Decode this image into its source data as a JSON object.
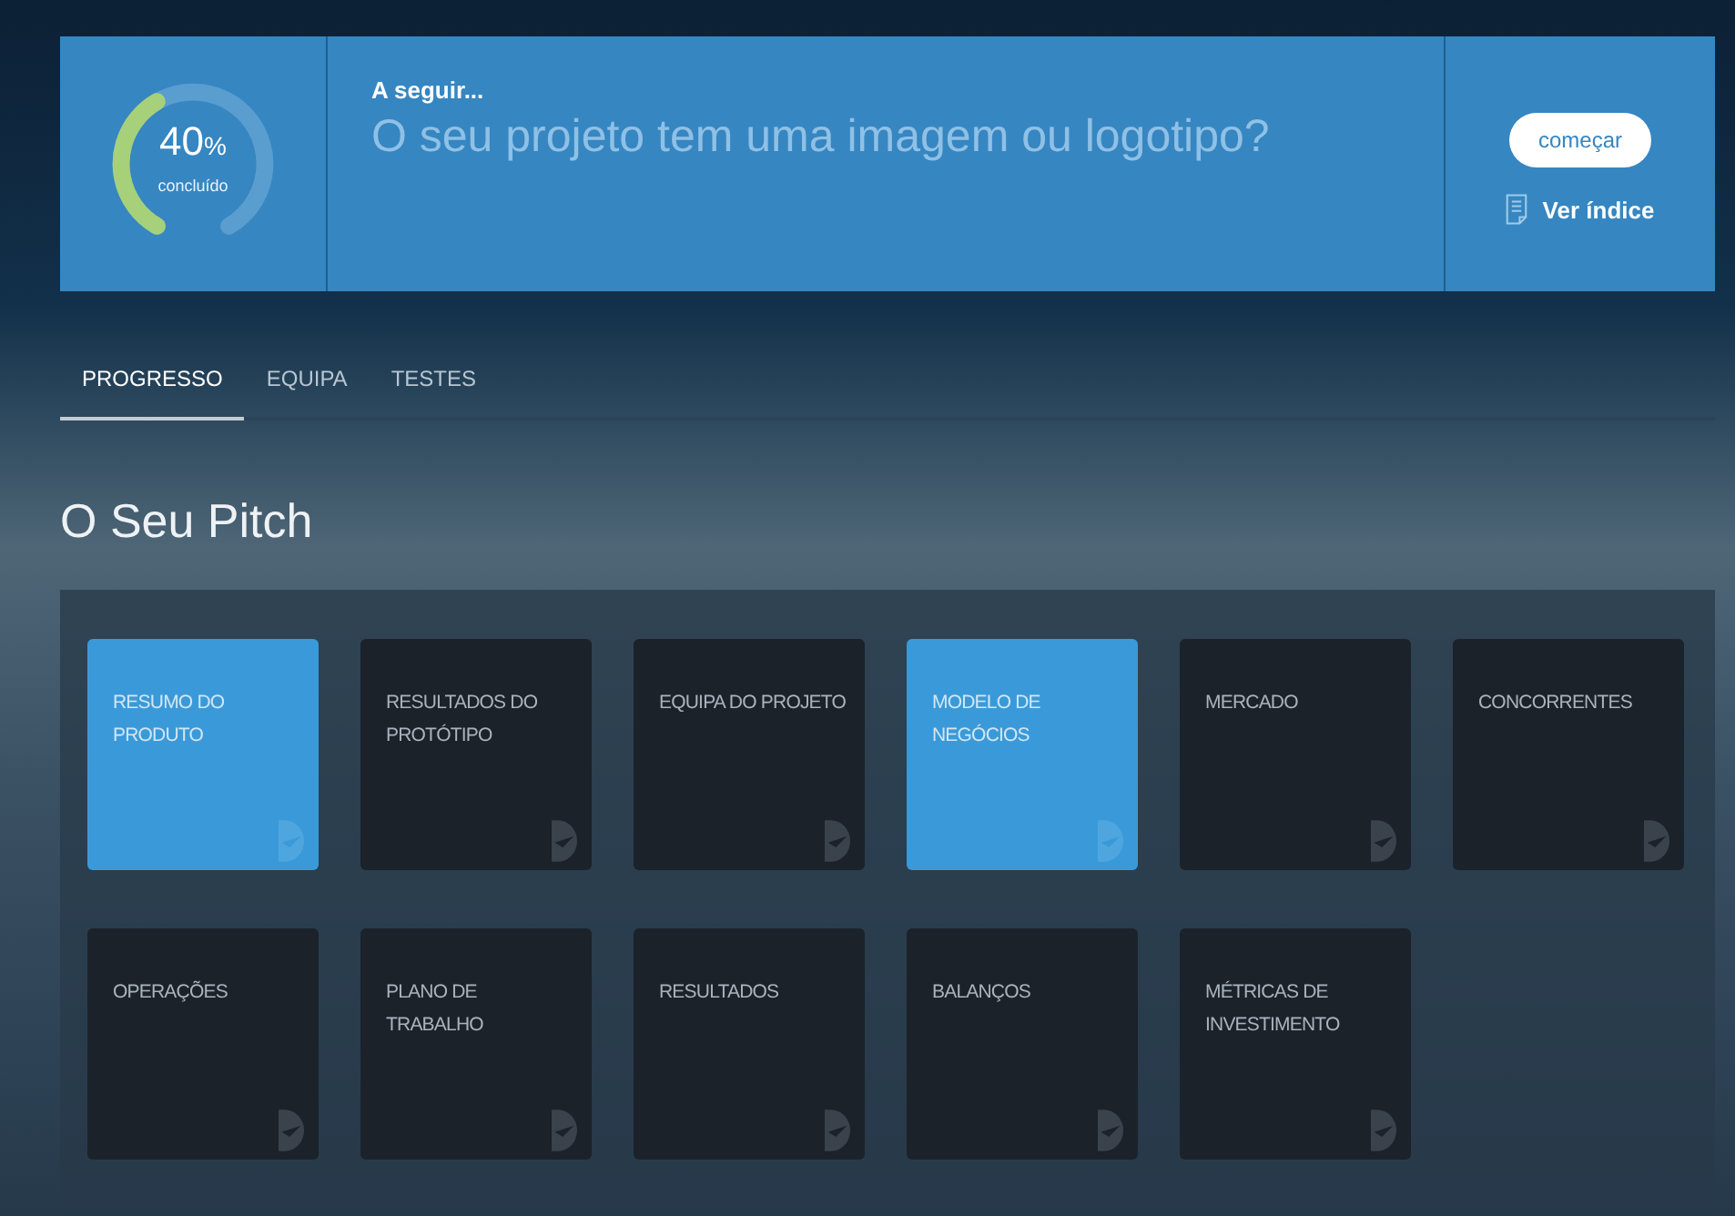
{
  "progress": {
    "value": "40",
    "unit": "%",
    "caption": "concluído"
  },
  "next": {
    "label": "A seguir...",
    "question": "O seu projeto tem uma imagem ou logotipo?"
  },
  "actions": {
    "start": "começar",
    "index": "Ver índice"
  },
  "tabs": [
    {
      "label": "PROGRESSO",
      "selected": true
    },
    {
      "label": "EQUIPA",
      "selected": false
    },
    {
      "label": "TESTES",
      "selected": false
    }
  ],
  "title": "O Seu Pitch",
  "cards": [
    {
      "label": "RESUMO DO PRODUTO",
      "done": true
    },
    {
      "label": "RESULTADOS DO PROTÓTIPO",
      "done": false
    },
    {
      "label": "EQUIPA DO PROJETO",
      "done": false
    },
    {
      "label": "MODELO DE NEGÓCIOS",
      "done": true
    },
    {
      "label": "MERCADO",
      "done": false
    },
    {
      "label": "CONCORRENTES",
      "done": false
    },
    {
      "label": "OPERAÇÕES",
      "done": false
    },
    {
      "label": "PLANO DE TRABALHO",
      "done": false
    },
    {
      "label": "RESULTADOS",
      "done": false
    },
    {
      "label": "BALANÇOS",
      "done": false
    },
    {
      "label": "MÉTRICAS DE INVESTIMENTO",
      "done": false
    }
  ]
}
